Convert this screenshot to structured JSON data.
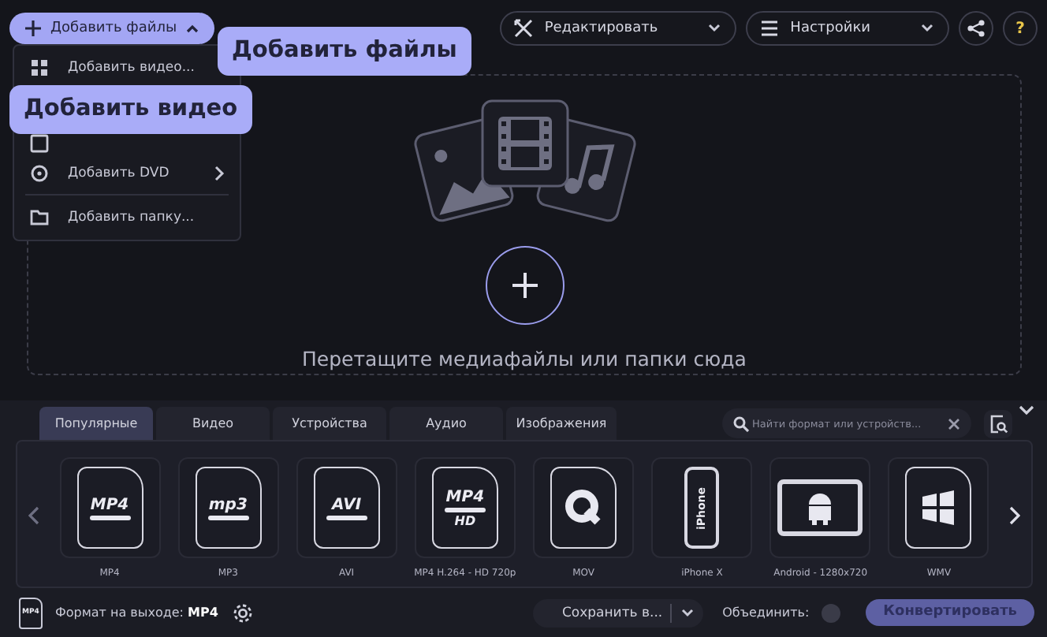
{
  "toolbar": {
    "add_button": {
      "label": "Добавить файлы",
      "expanded": true
    },
    "edit_button": {
      "label": "Редактировать"
    },
    "settings_button": {
      "label": "Настройки"
    },
    "help_label": "?"
  },
  "add_menu": [
    {
      "kind": "video",
      "label": "Добавить видео..."
    },
    {
      "kind": "image"
    },
    {
      "kind": "dvd",
      "label": "Добавить DVD",
      "has_submenu": true
    },
    {
      "kind": "folder",
      "label": "Добавить папку..."
    }
  ],
  "callouts": [
    {
      "text": "Добавить файлы"
    },
    {
      "text": "Добавить видео"
    }
  ],
  "drop_zone": {
    "hint": "Перетащите медиафайлы или папки сюда"
  },
  "tabs": [
    {
      "label": "Популярные",
      "selected": true
    },
    {
      "label": "Видео",
      "selected": false
    },
    {
      "label": "Устройства",
      "selected": false
    },
    {
      "label": "Аудио",
      "selected": false
    },
    {
      "label": "Изображения",
      "selected": false
    }
  ],
  "search": {
    "placeholder": "Найти формат или устройств..."
  },
  "formats": [
    {
      "kind": "doc",
      "icon_text": "MP4",
      "label": "MP4"
    },
    {
      "kind": "doc",
      "icon_text": "mp3",
      "label": "MP3"
    },
    {
      "kind": "doc",
      "icon_text": "AVI",
      "label": "AVI"
    },
    {
      "kind": "doc",
      "icon_text": "MP4",
      "icon_subtext": "HD",
      "label": "MP4 H.264 - HD 720p"
    },
    {
      "kind": "quicktime",
      "label": "MOV"
    },
    {
      "kind": "phone",
      "icon_text": "iPhone",
      "label": "iPhone X"
    },
    {
      "kind": "tablet",
      "label": "Android - 1280x720"
    },
    {
      "kind": "windows",
      "label": "WMV"
    }
  ],
  "bottom_bar": {
    "file_icon_text": "MP4",
    "output_format": "Формат на выходе: **MP4**",
    "save_button": "Сохранить в...",
    "merge_label": "Объединить:",
    "merge_on": false,
    "convert_button": "Конвертировать"
  }
}
